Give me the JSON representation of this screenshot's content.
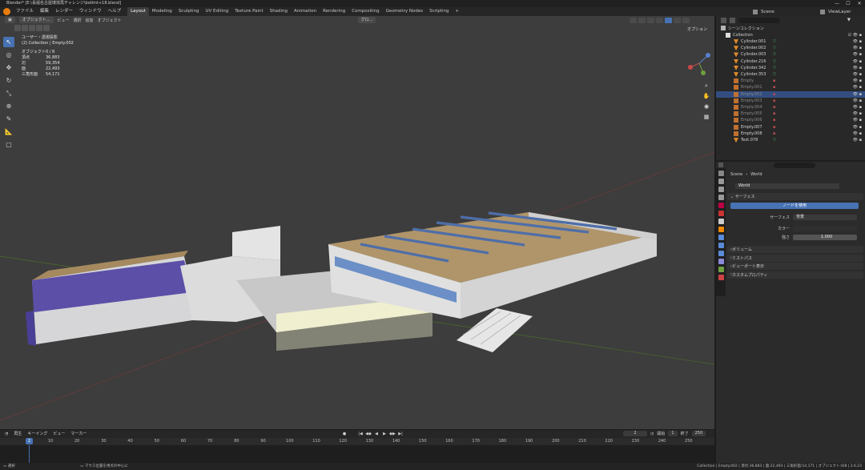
{
  "window": {
    "title": "Blender* [E:\\長堀名古屋環境再チャレンジ\\botlmt+18.blend]",
    "min": "—",
    "max": "☐",
    "close": "✕"
  },
  "menu": [
    "ファイル",
    "編集",
    "レンダー",
    "ウィンドウ",
    "ヘルプ"
  ],
  "workspace_tabs": [
    "Layout",
    "Modeling",
    "Sculpting",
    "UV Editing",
    "Texture Paint",
    "Shading",
    "Animation",
    "Rendering",
    "Compositing",
    "Geometry Nodes",
    "Scripting",
    "+"
  ],
  "scene": {
    "label": "Scene",
    "view_layer": "ViewLayer"
  },
  "viewport_header": {
    "mode": "オブジェクト...",
    "view": "ビュー",
    "select": "選択",
    "add": "追加",
    "object": "オブジェクト",
    "transform": "グロ...",
    "options": "オプション"
  },
  "overlay": {
    "view_name": "ユーザー・透視投影",
    "collection": "(2) Collection | Empty.002",
    "stats": [
      {
        "k": "オブジェクト",
        "v": "0 / 8"
      },
      {
        "k": "頂点",
        "v": "36,883"
      },
      {
        "k": "辺",
        "v": "59,354"
      },
      {
        "k": "面",
        "v": "22,493"
      },
      {
        "k": "三角形面",
        "v": "54,171"
      }
    ]
  },
  "outliner": {
    "title": "シーンコレクション",
    "collection": "Collection",
    "items": [
      {
        "name": "Cylinder.001",
        "dim": false,
        "sel": false
      },
      {
        "name": "Cylinder.002",
        "dim": false,
        "sel": false
      },
      {
        "name": "Cylinder.003",
        "dim": false,
        "sel": false
      },
      {
        "name": "Cylinder.216",
        "dim": false,
        "sel": false
      },
      {
        "name": "Cylinder.342",
        "dim": false,
        "sel": false
      },
      {
        "name": "Cylinder.353",
        "dim": false,
        "sel": false
      },
      {
        "name": "Empty",
        "dim": true,
        "sel": false
      },
      {
        "name": "Empty.001",
        "dim": true,
        "sel": false
      },
      {
        "name": "Empty.002",
        "dim": true,
        "sel": true
      },
      {
        "name": "Empty.003",
        "dim": true,
        "sel": false
      },
      {
        "name": "Empty.004",
        "dim": true,
        "sel": false
      },
      {
        "name": "Empty.005",
        "dim": true,
        "sel": false
      },
      {
        "name": "Empty.006",
        "dim": true,
        "sel": false
      },
      {
        "name": "Empty.007",
        "dim": false,
        "sel": false
      },
      {
        "name": "Empty.008",
        "dim": false,
        "sel": false
      },
      {
        "name": "Text.078",
        "dim": false,
        "sel": false
      }
    ]
  },
  "properties": {
    "breadcrumb_scene": "Scene",
    "breadcrumb_world": "World",
    "world_field": "World",
    "surface_panel": "サーフェス",
    "use_nodes": "ノードを使用",
    "surface_label": "サーフェス",
    "surface_value": "背景",
    "color_label": "カラー",
    "strength_label": "強さ",
    "strength_value": "1.000",
    "panels": [
      "ボリューム",
      "ミストパス",
      "ビューポート表示",
      "カスタムプロパティ"
    ]
  },
  "timeline": {
    "play": "再生",
    "keying": "キーイング",
    "view": "ビュー",
    "marker": "マーカー",
    "current_frame": "2",
    "start_label": "開始",
    "start": "1",
    "end_label": "終了",
    "end": "250",
    "playhead": "2",
    "ticks": [
      "10",
      "20",
      "30",
      "40",
      "50",
      "60",
      "70",
      "80",
      "90",
      "100",
      "110",
      "120",
      "130",
      "140",
      "150",
      "160",
      "170",
      "180",
      "190",
      "200",
      "210",
      "220",
      "230",
      "240",
      "250"
    ]
  },
  "status": {
    "left": "選択",
    "middle": "マウス位置を視点の中心に",
    "right": "Collection | Empty.002 | 頂点:36,883 | 面:22,493 | 三角形面:54,171 | オブジェクト:0/8 | 3.6.23"
  },
  "colors": {
    "accent": "#4772b3",
    "viewport": "#3d3d3d",
    "panel": "#282828"
  }
}
